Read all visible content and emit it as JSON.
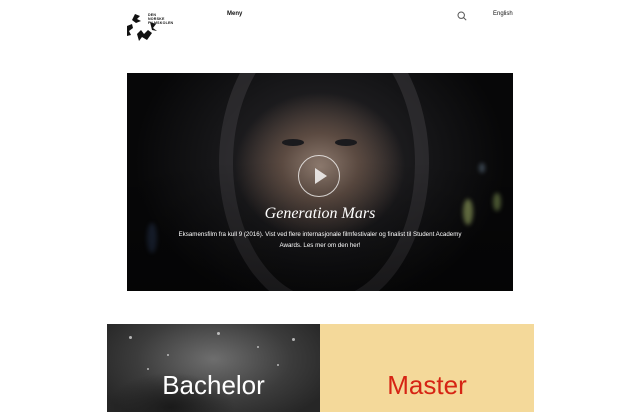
{
  "header": {
    "logo_lines": [
      "DEN",
      "NORSKE",
      "FILMSKOLEN"
    ],
    "menu_label": "Meny",
    "language_label": "English"
  },
  "hero": {
    "title": "Generation Mars",
    "description": "Eksamensfilm fra kull 9 (2016). Vist ved flere internasjonale filmfestivaler og finalist til Student Academy Awards. Les mer om den her!"
  },
  "cards": {
    "bachelor_label": "Bachelor",
    "master_label": "Master"
  },
  "colors": {
    "master_bg": "#f4d99a",
    "master_text": "#d62414"
  }
}
